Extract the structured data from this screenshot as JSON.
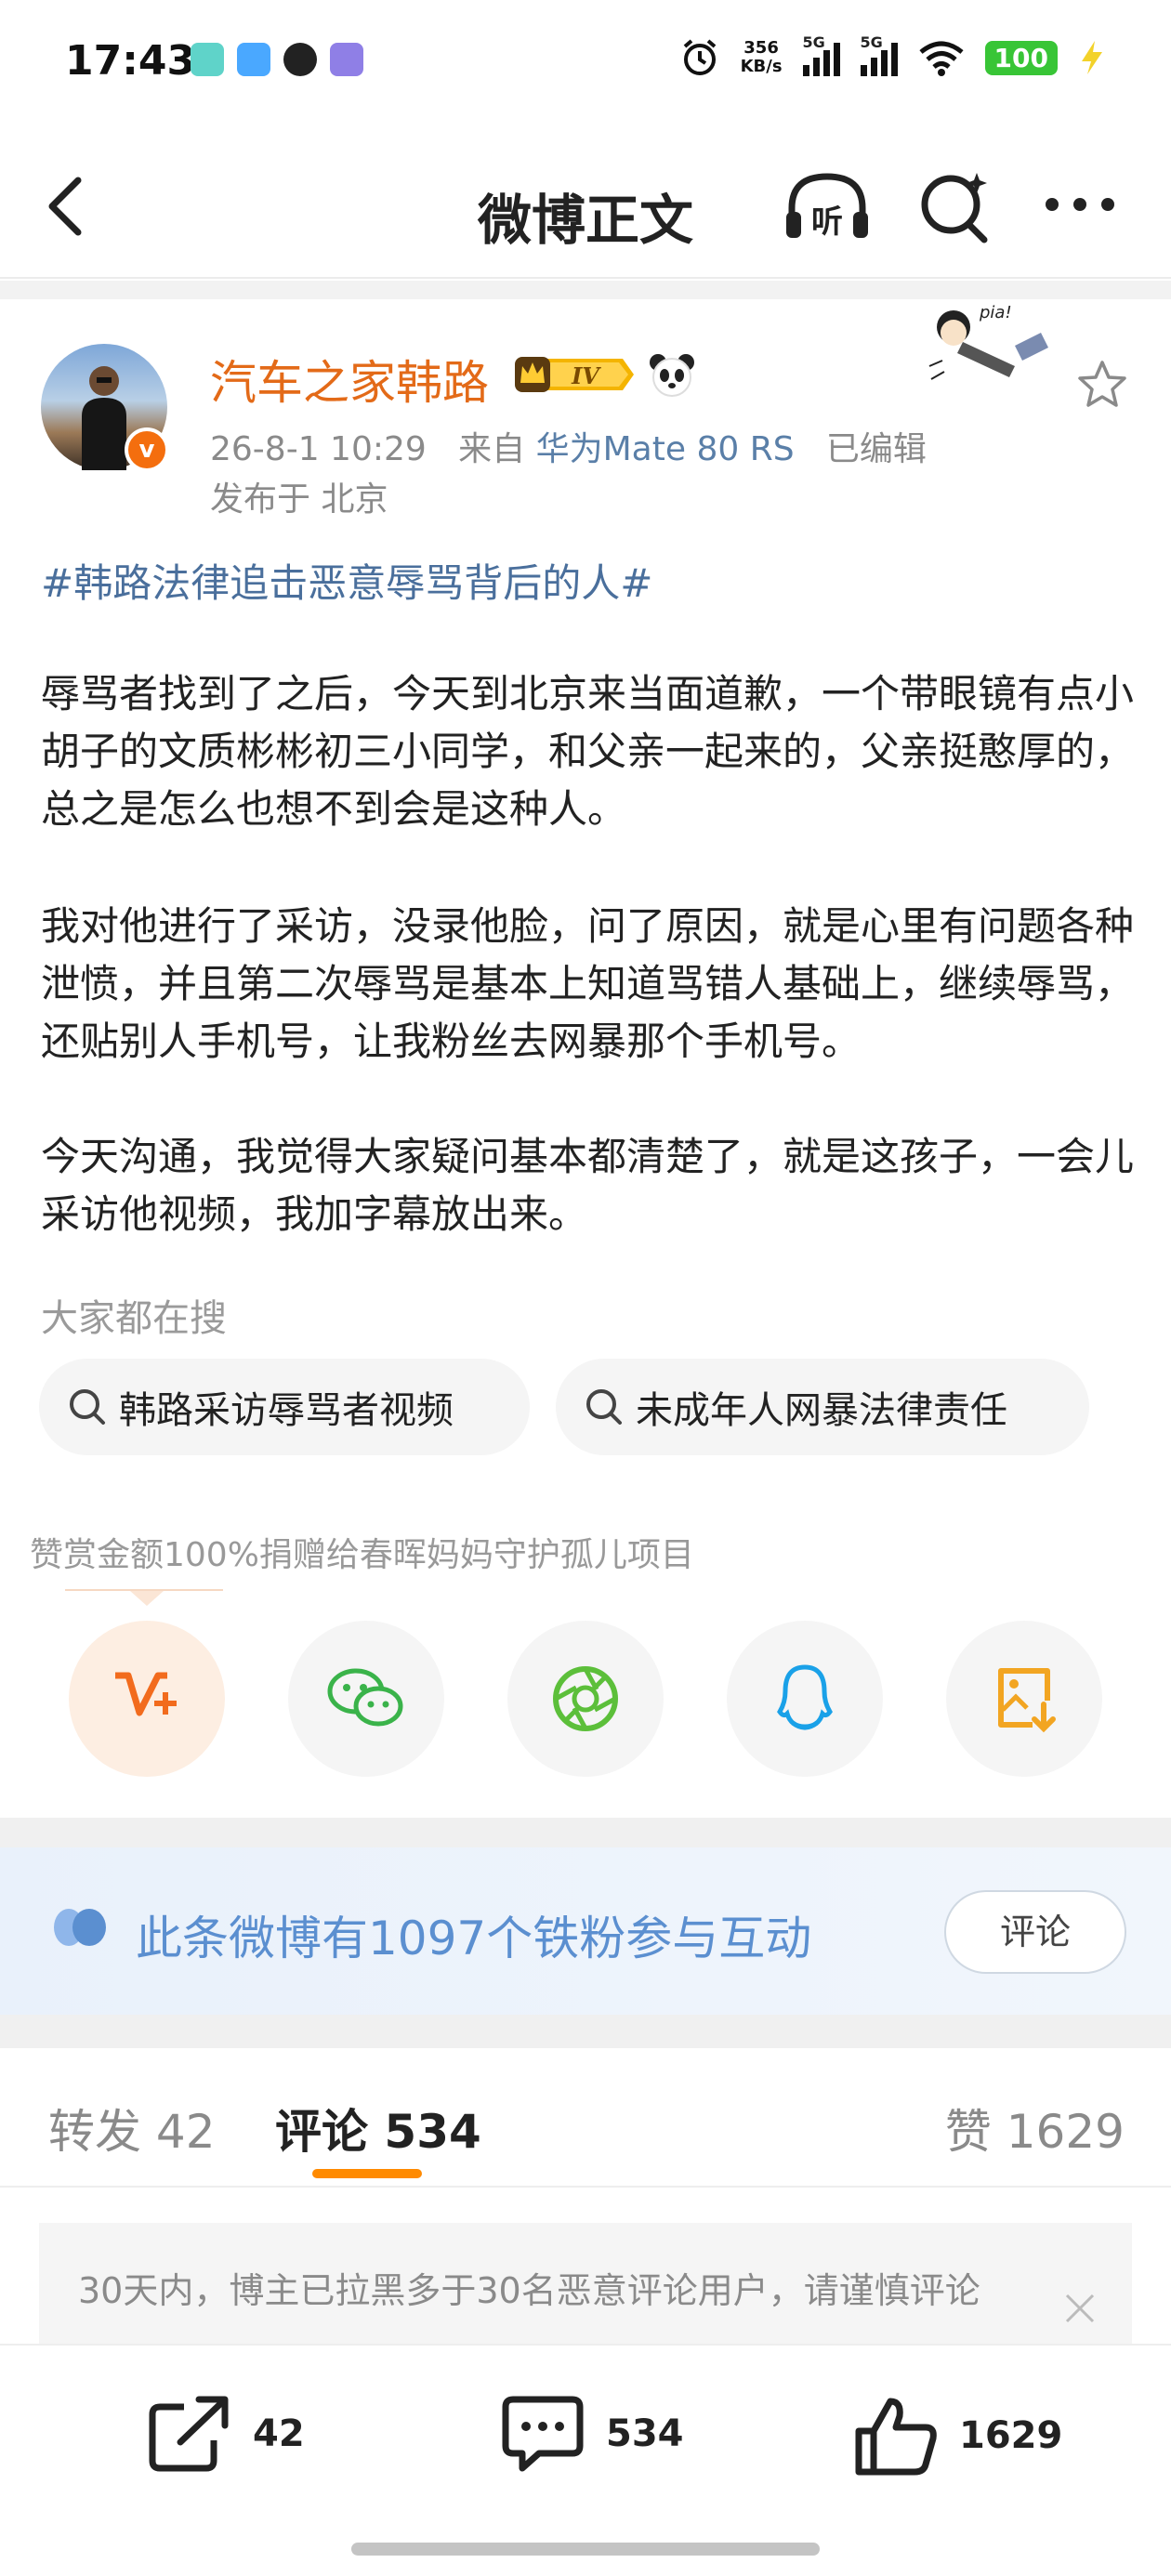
{
  "status_bar": {
    "time": "17:43",
    "net_speed_value": "356",
    "net_speed_unit": "KB/s",
    "signal1_label": "5G",
    "signal2_label": "5G",
    "battery": "100"
  },
  "nav": {
    "title": "微博正文"
  },
  "post": {
    "author": "汽车之家韩路",
    "verified_mark": "v",
    "date": "26-8-1 10:29",
    "source_prefix": "来自",
    "device": "华为Mate 80 RS",
    "edited": "已编辑",
    "location": "发布于 北京",
    "hashtag": "#韩路法律追击恶意辱骂背后的人#",
    "paragraphs": [
      "辱骂者找到了之后，今天到北京来当面道歉，一个带眼镜有点小胡子的文质彬彬初三小同学，和父亲一起来的，父亲挺憨厚的，总之是怎么也想不到会是这种人。",
      "我对他进行了采访，没录他脸，问了原因，就是心里有问题各种泄愤，并且第二次辱骂是基本上知道骂错人基础上，继续辱骂，还贴别人手机号，让我粉丝去网暴那个手机号。",
      "今天沟通，我觉得大家疑问基本都清楚了，就是这孩子，一会儿采访他视频，我加字幕放出来。"
    ]
  },
  "search": {
    "title": "大家都在搜",
    "chips": [
      "韩路采访辱骂者视频",
      "未成年人网暴法律责任"
    ]
  },
  "reward": {
    "text": "赞赏金额100%捐赠给春晖妈妈守护孤儿项目"
  },
  "share_icons": [
    "vplus-icon",
    "wechat-icon",
    "moments-icon",
    "qq-icon",
    "save-image-icon"
  ],
  "fans_banner": {
    "text": "此条微博有1097个铁粉参与互动",
    "button": "评论"
  },
  "tabs": {
    "repost_label": "转发",
    "repost_count": "42",
    "comment_label": "评论",
    "comment_count": "534",
    "like_label": "赞",
    "like_count": "1629"
  },
  "notice": {
    "text": "30天内，博主已拉黑多于30名恶意评论用户，请谨慎评论"
  },
  "bottom_bar": {
    "repost": "42",
    "comment": "534",
    "like": "1629"
  },
  "colors": {
    "author": "#e36a18",
    "link": "#4a6f9c",
    "accent": "#ff8a00",
    "fans_text": "#5b8fd0"
  }
}
